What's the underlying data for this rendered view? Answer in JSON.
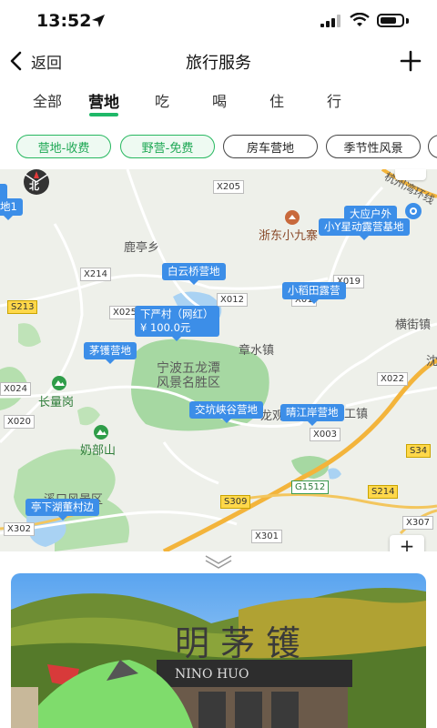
{
  "status_bar": {
    "time": "13:52"
  },
  "header": {
    "back_label": "返回",
    "title": "旅行服务"
  },
  "tabs": [
    {
      "label": "全部"
    },
    {
      "label": "营地"
    },
    {
      "label": "吃"
    },
    {
      "label": "喝"
    },
    {
      "label": "住"
    },
    {
      "label": "行"
    }
  ],
  "active_tab": "营地",
  "chips": [
    {
      "label": "营地-收费"
    },
    {
      "label": "野营-免费"
    },
    {
      "label": "房车营地"
    },
    {
      "label": "季节性风景"
    }
  ],
  "map": {
    "compass_label": "北",
    "place_names": {
      "luting": "鹿亭乡",
      "zhangshui": "章水镇",
      "wulongtan_1": "宁波五龙潭",
      "wulongtan_2": "风景名胜区",
      "changliang": "长量岗",
      "naibu": "奶部山",
      "hengjie": "横街镇",
      "xikou": "溪口风景区",
      "zhedong": "浙东小九寨",
      "hangzhouwan": "杭州湾环线",
      "shen": "沈",
      "gongzhen": "工镇",
      "longxiang": "龙观乡"
    },
    "pins": {
      "dayinghuwai": "大应户外",
      "xiaoy": "小Y星动露营基地",
      "baiyunqiao": "白云桥营地",
      "xiaodaotian": "小稻田露营",
      "xiayancun": "下严村（网红）",
      "xiayancun_price": "¥ 100.0元",
      "maohuo": "茅镬营地",
      "jiaokeng": "交坑峡谷营地",
      "qingjiang": "晴江岸营地",
      "tingxia": "亭下湖董村边",
      "edge1": "地1"
    },
    "roads": {
      "x205": "X205",
      "x214": "X214",
      "x019": "X019",
      "x012": "X012",
      "x012b": "X01",
      "x025": "X025",
      "s213": "S213",
      "x024": "X024",
      "x020": "X020",
      "x022": "X022",
      "x003": "X003",
      "s34": "S34",
      "g1512": "G1512",
      "s214": "S214",
      "s309": "S309",
      "x302": "X302",
      "x301": "X301",
      "x307": "X307"
    },
    "zoom_label": "+"
  },
  "colors": {
    "accent": "#1fb868",
    "pin": "#3c8ee8",
    "highway": "#f3b43b"
  }
}
